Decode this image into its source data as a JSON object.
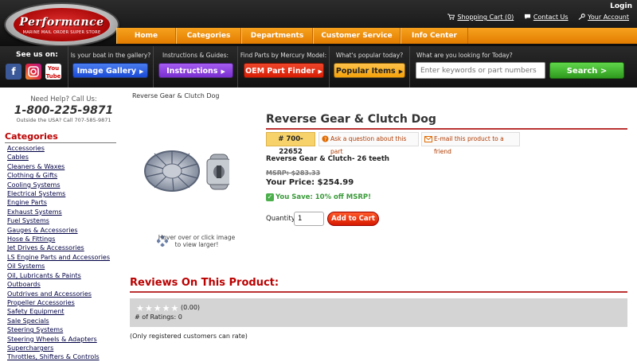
{
  "logo": {
    "brand": "Performance",
    "tagline": "MARINE MAIL ORDER SUPER STORE"
  },
  "util": {
    "login": "Login",
    "cart": "Shopping Cart (0)",
    "contact": "Contact Us",
    "account": "Your Account"
  },
  "nav": [
    "Home",
    "Categories",
    "Departments",
    "Customer Service",
    "Info Center"
  ],
  "toolbar": {
    "see_us_on": "See us on:",
    "gallery_caption": "Is your boat in the gallery?",
    "gallery_button": "Image Gallery",
    "instructions_caption": "Instructions & Guides:",
    "instructions_button": "Instructions",
    "oem_caption": "Find Parts by Mercury Model:",
    "oem_button": "OEM Part Finder",
    "popular_caption": "What's popular today?",
    "popular_button": "Popular Items",
    "search_caption": "What are you looking for Today?",
    "search_placeholder": "Enter keywords or part numbers",
    "search_button": "Search >"
  },
  "colors": {
    "gallery": "#1a4bd6",
    "instructions": "#7a2fd0",
    "oem": "#d81e05",
    "popular": "#f5a20a",
    "search": "#3cb12a",
    "nav": "#f08a00",
    "accent": "#b00000"
  },
  "help": {
    "need": "Need Help? Call Us:",
    "phone": "1-800-225-9871",
    "outside": "Outside the USA? Call 707-585-9871"
  },
  "categories_title": "Categories",
  "categories": [
    "Accessories",
    "Cables",
    "Cleaners & Waxes",
    "Clothing & Gifts",
    "Cooling Systems",
    "Electrical Systems",
    "Engine Parts",
    "Exhaust Systems",
    "Fuel Systems",
    "Gauges & Accessories",
    "Hose & Fittings",
    "Jet Drives & Accessories",
    "LS Engine Parts and Accessories",
    "Oil Systems",
    "Oil, Lubricants & Paints",
    "Outboards",
    "Outdrives and Accessories",
    "Propeller Accessories",
    "Safety Equipment",
    "Sale Specials",
    "Steering Systems",
    "Steering Wheels & Adapters",
    "Superchargers",
    "Throttles, Shifters & Controls"
  ],
  "breadcrumb": "Reverse Gear & Clutch Dog",
  "product": {
    "title": "Reverse Gear & Clutch Dog",
    "sku": "# 700-22652",
    "ask": "Ask a question about this part",
    "email": "E-mail this product to a friend",
    "subtitle": "Reverse Gear & Clutch- 26 teeth",
    "msrp": "MSRP: $283.33",
    "price": "Your Price: $254.99",
    "save": "You Save: 10% off MSRP!",
    "hover": "Hover over or click image to view larger!",
    "qty_label": "Quantity",
    "qty_value": "1",
    "add_to_cart": "Add to Cart"
  },
  "reviews": {
    "title": "Reviews On This Product:",
    "rating": "(0.00)",
    "count": "# of Ratings: 0",
    "note": "(Only registered customers can rate)"
  }
}
